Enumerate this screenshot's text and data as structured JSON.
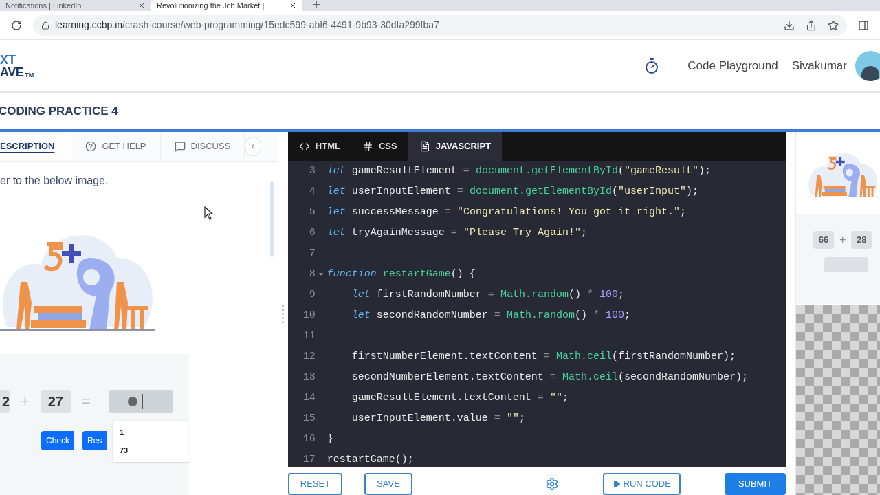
{
  "browser": {
    "tabs": [
      {
        "title": "Notifications | LinkedIn",
        "selected": false
      },
      {
        "title": "Revolutionizing the Job Market |",
        "selected": true
      }
    ],
    "url_host": "learning.ccbp.in",
    "url_path": "/crash-course/web-programming/15edc599-abf6-4491-9b93-30dfa299fba7"
  },
  "header": {
    "logo_top": "XT",
    "logo_bottom": "AVE",
    "logo_mark": "TM",
    "link": "Code Playground",
    "user": "Sivakumar"
  },
  "title": "CODING PRACTICE 4",
  "left_panel": {
    "tabs": [
      {
        "label": "ESCRIPTION",
        "kind": "text",
        "selected": true
      },
      {
        "label": "GET HELP",
        "kind": "help",
        "selected": false
      },
      {
        "label": "DISCUSS",
        "kind": "chat",
        "selected": false
      }
    ],
    "instruction": "er to the below image.",
    "game": {
      "first": "2",
      "operator": "+",
      "second": "27",
      "equals": "=",
      "suggestions": [
        "1",
        "73"
      ],
      "buttons": [
        "Check",
        "Res"
      ]
    }
  },
  "editor": {
    "tabs": [
      {
        "label": "HTML",
        "kind": "html",
        "selected": false
      },
      {
        "label": "CSS",
        "kind": "css",
        "selected": false
      },
      {
        "label": "JAVASCRIPT",
        "kind": "js",
        "selected": true
      }
    ],
    "lines": [
      {
        "number": "3",
        "tokens": [
          {
            "kind": "kw",
            "text": "let"
          },
          {
            "kind": "var",
            "text": " gameResultElement "
          },
          {
            "kind": "op",
            "text": "="
          },
          {
            "kind": "fn",
            "text": " document.getElementById"
          },
          {
            "kind": "pun",
            "text": "("
          },
          {
            "kind": "str",
            "text": "\"gameResult\""
          },
          {
            "kind": "pun",
            "text": ");"
          }
        ]
      },
      {
        "number": "4",
        "tokens": [
          {
            "kind": "kw",
            "text": "let"
          },
          {
            "kind": "var",
            "text": " userInputElement "
          },
          {
            "kind": "op",
            "text": "="
          },
          {
            "kind": "fn",
            "text": " document.getElementById"
          },
          {
            "kind": "pun",
            "text": "("
          },
          {
            "kind": "str",
            "text": "\"userInput\""
          },
          {
            "kind": "pun",
            "text": ");"
          }
        ]
      },
      {
        "number": "5",
        "tokens": [
          {
            "kind": "kw",
            "text": "let"
          },
          {
            "kind": "var",
            "text": " successMessage "
          },
          {
            "kind": "op",
            "text": "="
          },
          {
            "kind": "str",
            "text": " \"Congratulations! You got it right.\""
          },
          {
            "kind": "pun",
            "text": ";"
          }
        ]
      },
      {
        "number": "6",
        "tokens": [
          {
            "kind": "kw",
            "text": "let"
          },
          {
            "kind": "var",
            "text": " tryAgainMessage "
          },
          {
            "kind": "op",
            "text": "="
          },
          {
            "kind": "str",
            "text": " \"Please Try Again!\""
          },
          {
            "kind": "pun",
            "text": ";"
          }
        ]
      },
      {
        "number": "7"
      },
      {
        "number": "8",
        "tokens": [
          {
            "kind": "kw",
            "text": "function"
          },
          {
            "kind": "fn",
            "text": " restartGame"
          },
          {
            "kind": "pun",
            "text": "() {"
          }
        ],
        "children": [
          {
            "number": "9",
            "tokens": [
              {
                "kind": "kw",
                "text": "let"
              },
              {
                "kind": "var",
                "text": " firstRandomNumber "
              },
              {
                "kind": "op",
                "text": "="
              },
              {
                "kind": "fn",
                "text": " Math.random"
              },
              {
                "kind": "pun",
                "text": "() "
              },
              {
                "kind": "op",
                "text": "*"
              },
              {
                "kind": "num",
                "text": " 100"
              },
              {
                "kind": "pun",
                "text": ";"
              }
            ]
          },
          {
            "number": "10",
            "tokens": [
              {
                "kind": "kw",
                "text": "let"
              },
              {
                "kind": "var",
                "text": " secondRandomNumber "
              },
              {
                "kind": "op",
                "text": "="
              },
              {
                "kind": "fn",
                "text": " Math.random"
              },
              {
                "kind": "pun",
                "text": "() "
              },
              {
                "kind": "op",
                "text": "*"
              },
              {
                "kind": "num",
                "text": " 100"
              },
              {
                "kind": "pun",
                "text": ";"
              }
            ]
          },
          {
            "number": "11"
          },
          {
            "number": "12",
            "tokens": [
              {
                "kind": "var",
                "text": "firstNumberElement.textContent "
              },
              {
                "kind": "op",
                "text": "="
              },
              {
                "kind": "fn",
                "text": " Math.ceil"
              },
              {
                "kind": "pun",
                "text": "(firstRandomNumber);"
              }
            ]
          },
          {
            "number": "13",
            "tokens": [
              {
                "kind": "var",
                "text": "secondNumberElement.textContent "
              },
              {
                "kind": "op",
                "text": "="
              },
              {
                "kind": "fn",
                "text": " Math.ceil"
              },
              {
                "kind": "pun",
                "text": "(secondRandomNumber);"
              }
            ]
          },
          {
            "number": "14",
            "tokens": [
              {
                "kind": "var",
                "text": "gameResultElement.textContent "
              },
              {
                "kind": "op",
                "text": "="
              },
              {
                "kind": "str",
                "text": " \"\""
              },
              {
                "kind": "pun",
                "text": ";"
              }
            ]
          },
          {
            "number": "15",
            "tokens": [
              {
                "kind": "var",
                "text": "userInputElement.value "
              },
              {
                "kind": "op",
                "text": "="
              },
              {
                "kind": "str",
                "text": " \"\""
              },
              {
                "kind": "pun",
                "text": ";"
              }
            ]
          }
        ]
      },
      {
        "number": "16",
        "tokens": [
          {
            "kind": "pun",
            "text": "}"
          }
        ]
      },
      {
        "number": "17",
        "tokens": [
          {
            "kind": "var",
            "text": "restartGame();"
          }
        ]
      }
    ],
    "toolbar": [
      {
        "kind": "outline",
        "label": "RESET"
      },
      {
        "kind": "outline",
        "label": "SAVE"
      },
      {
        "kind": "settings"
      },
      {
        "kind": "run",
        "label": "RUN CODE"
      },
      {
        "kind": "primary",
        "label": "SUBMIT"
      }
    ]
  },
  "preview": {
    "first": "66",
    "operator": "+",
    "second": "28"
  }
}
